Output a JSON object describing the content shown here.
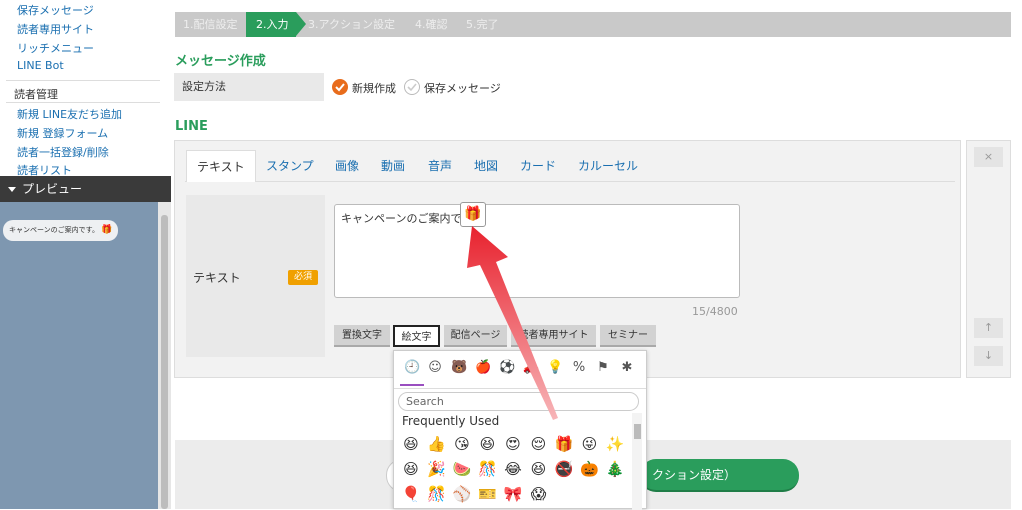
{
  "sidebar": {
    "links_top": [
      "保存メッセージ",
      "読者専用サイト",
      "リッチメニュー",
      "LINE Bot"
    ],
    "heading": "読者管理",
    "links_bottom": [
      "新規 LINE友だち追加",
      "新規 登録フォーム",
      "読者一括登録/削除",
      "読者リスト"
    ],
    "preview_label": "プレビュー",
    "preview_bubble_text": "キャンペーンのご案内です。"
  },
  "steps": [
    "1.配信設定",
    "2.入力",
    "3.アクション設定",
    "4.確認",
    "5.完了"
  ],
  "message_section": {
    "title": "メッセージ作成",
    "method_label": "設定方法",
    "options": [
      "新規作成",
      "保存メッセージ"
    ]
  },
  "line_section": {
    "title": "LINE",
    "tabs": [
      "テキスト",
      "スタンプ",
      "画像",
      "動画",
      "音声",
      "地図",
      "カード",
      "カルーセル"
    ],
    "field_label": "テキスト",
    "required_badge": "必須",
    "text_value": "キャンペーンのご案内です。",
    "char_count": "15/4800",
    "buttons": [
      "置換文字",
      "絵文字",
      "配信ページ",
      "読者専用サイト",
      "セミナー"
    ],
    "close_symbol": "×",
    "up_symbol": "↑",
    "down_symbol": "↓"
  },
  "next_button_label": "クション設定）",
  "emoji_picker": {
    "search_placeholder": "Search",
    "section_label": "Frequently Used",
    "category_icons": [
      "clock-icon",
      "smiley-icon",
      "animal-icon",
      "food-icon",
      "sports-icon",
      "car-icon",
      "bulb-icon",
      "symbols-icon",
      "flag-icon",
      "asterisk-icon"
    ],
    "emojis": [
      "😆",
      "👍",
      "😘",
      "😆",
      "😍",
      "😌",
      "🎁",
      "😜",
      "✨",
      "😆",
      "🎉",
      "🍉",
      "🎊",
      "😂",
      "😆",
      "🚭",
      "🎃",
      "🎄",
      "🎈",
      "🎊",
      "⚾",
      "🎫",
      "🎀",
      "😱"
    ]
  },
  "colors": {
    "accent": "#2a9d5c",
    "link": "#1a6fb0",
    "arrow": "#e8222e",
    "required": "#f0a000"
  }
}
